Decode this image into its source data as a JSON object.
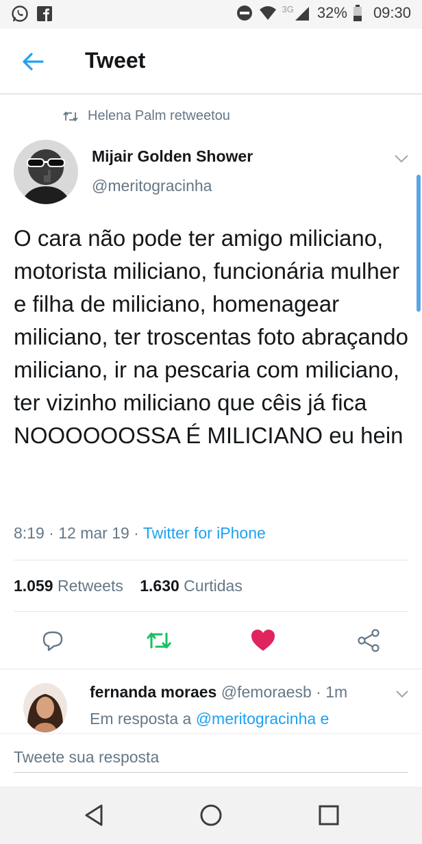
{
  "status_bar": {
    "network": "3G",
    "battery": "32%",
    "time": "09:30"
  },
  "app_bar": {
    "title": "Tweet"
  },
  "tweet": {
    "retweet_context": "Helena Palm retweetou",
    "author_name": "Mijair Golden Shower",
    "author_handle": "@meritogracinha",
    "text": "O cara não pode ter amigo miliciano, motorista miliciano, funcionária mulher e filha de miliciano, homenagear miliciano, ter troscentas foto abraçando miliciano, ir na pescaria com miliciano, ter vizinho miliciano que cêis já fica NOOOOOOSSA É MILICIANO eu hein",
    "time": "8:19",
    "date": "12 mar 19",
    "source": "Twitter for iPhone",
    "retweets_count": "1.059",
    "retweets_label": "Retweets",
    "likes_count": "1.630",
    "likes_label": "Curtidas"
  },
  "icons": {
    "reply": "reply-icon",
    "retweet": "retweet-icon",
    "like": "heart-icon",
    "share": "share-icon"
  },
  "colors": {
    "accent": "#1da1f2",
    "retweet": "#17bf63",
    "like": "#e0245e",
    "secondary_text": "#657786"
  },
  "reply": {
    "name": "fernanda moraes",
    "handle": "@femoraesb",
    "time": "1m",
    "in_reply_prefix": "Em resposta a",
    "in_reply_mention": "@meritogracinha e"
  },
  "compose": {
    "placeholder": "Tweete sua resposta"
  }
}
